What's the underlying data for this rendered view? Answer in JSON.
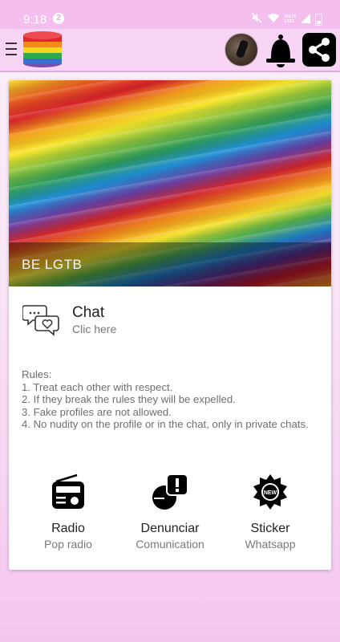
{
  "status_bar": {
    "time": "9:18",
    "notification_count": "2",
    "network_label": "VoLTE LTE1"
  },
  "app_bar": {
    "icons": [
      "menu-icon",
      "rainbow-logo",
      "avatar",
      "bell-icon",
      "share-icon"
    ]
  },
  "hero": {
    "caption": "BE LGTB"
  },
  "chat": {
    "title": "Chat",
    "subtitle": "Clic here"
  },
  "rules": {
    "heading": "Rules:",
    "items": [
      "1. Treat each other with respect.",
      "2. If they break the rules they will be expelled.",
      "3. Fake profiles are not allowed.",
      "4. No nudity on the profile or in the chat, only in private chats."
    ]
  },
  "actions": [
    {
      "label": "Radio",
      "sub": "Pop radio",
      "icon": "radio-icon"
    },
    {
      "label": "Denunciar",
      "sub": "Comunication",
      "icon": "report-icon"
    },
    {
      "label": "Sticker",
      "sub": "Whatsapp",
      "icon": "new-badge-icon"
    }
  ],
  "colors": {
    "status_bar": "#f4bfef",
    "app_bar": "#f7d4f3",
    "accent_pink": "#e7a9e1"
  }
}
